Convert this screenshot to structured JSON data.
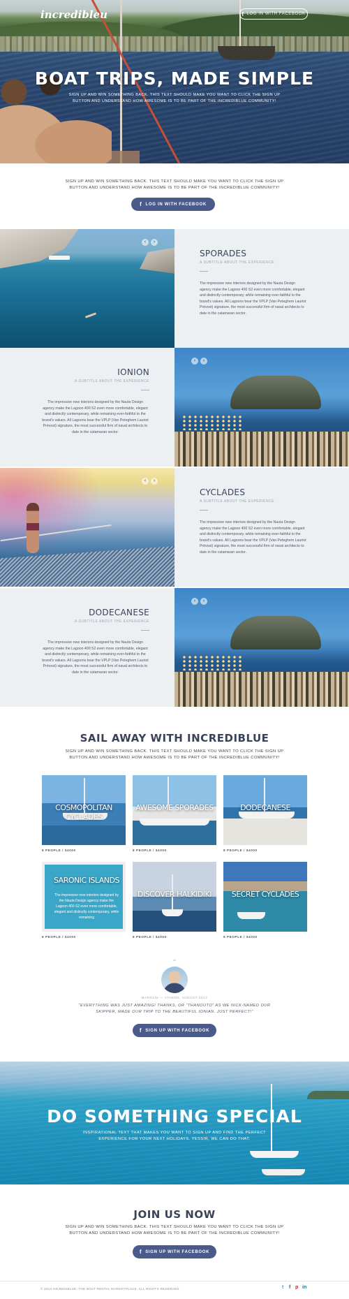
{
  "header": {
    "logo": "incredibleu",
    "login_button": "LOG IN WITH FACEBOOK"
  },
  "hero": {
    "title": "BOAT TRIPS, MADE SIMPLE",
    "subtitle": "SIGN UP AND WIN SOMETHING BACK. THIS TEXT SHOULD MAKE YOU WANT TO CLICK THE SIGN UP BUTTON AND UNDERSTAND HOW AWESOME IS TO BE PART OF THE INCREDIBLUE COMMUNITY!"
  },
  "intro": {
    "text": "SIGN UP AND WIN SOMETHING BACK. THIS TEXT SHOULD MAKE YOU WANT TO CLICK THE SIGN UP BUTTON AND UNDERSTAND HOW AWESOME IS TO BE PART OF THE INCREDIBLUE COMMUNITY!",
    "button": "LOG IN WITH FACEBOOK"
  },
  "destinations": [
    {
      "title": "SPORADES",
      "subtitle": "A SUBTITLE ABOUT THE EXPERIENCE",
      "body": "The impressive new interiors designed by the Nauta Design agency make the Lagoon 400 S2 even more comfortable, elegant and distinctly contemporary, while remaining ever-faithful to the brand's values. All Lagoons bear the VPLP (Van Peteghem Lauriot Prévost) signature, the most successful firm of naval architects to date in the catamaran sector."
    },
    {
      "title": "IONION",
      "subtitle": "A SUBTITLE ABOUT THE EXPERIENCE",
      "body": "The impressive new interiors designed by the Nauta Design agency make the Lagoon 400 S2 even more comfortable, elegant and distinctly contemporary, while remaining ever-faithful to the brand's values. All Lagoons bear the VPLP (Van Peteghem Lauriot Prévost) signature, the most successful firm of naval architects to date in the catamaran sector."
    },
    {
      "title": "CYCLADES",
      "subtitle": "A SUBTITLE ABOUT THE EXPERIENCE",
      "body": "The impressive new interiors designed by the Nauta Design agency make the Lagoon 400 S2 even more comfortable, elegant and distinctly contemporary, while remaining ever-faithful to the brand's values. All Lagoons bear the VPLP (Van Peteghem Lauriot Prévost) signature, the most successful firm of naval architects to date in the catamaran sector."
    },
    {
      "title": "DODECANESE",
      "subtitle": "A SUBTITLE ABOUT THE EXPERIENCE",
      "body": "The impressive new interiors designed by the Nauta Design agency make the Lagoon 400 S2 even more comfortable, elegant and distinctly contemporary, while remaining ever-faithful to the brand's values. All Lagoons bear the VPLP (Van Peteghem Lauriot Prévost) signature, the most successful firm of naval architects to date in the catamaran sector."
    }
  ],
  "sail_away": {
    "title": "SAIL AWAY WITH INCREDIBLUE",
    "text": "SIGN UP AND WIN SOMETHING BACK. THIS TEXT SHOULD MAKE YOU WANT TO CLICK THE SIGN UP BUTTON AND UNDERSTAND HOW AWESOME IS TO BE PART OF THE INCREDIBLUE COMMUNITY!",
    "tours": [
      {
        "label": "COSMOPOLITAN CYCLADES",
        "info": "8 PEOPLE / $4000"
      },
      {
        "label": "AWESOME SPORADES",
        "info": "8 PEOPLE / $4000"
      },
      {
        "label": "DODECANESE",
        "info": "8 PEOPLE / $4000"
      },
      {
        "label": "SARONIC ISLANDS",
        "info": "8 PEOPLE / $4000",
        "desc": "The impressive new interiors designed by the Nauta Design agency make the Lagoon 400 S2 even more comfortable, elegant and distinctly contemporary, while remaining"
      },
      {
        "label": "DISCOVER HALKIDIKI",
        "info": "8 PEOPLE / $4000"
      },
      {
        "label": "SECRET CYCLADES",
        "info": "8 PEOPLE / $4000"
      }
    ]
  },
  "testimonial": {
    "quote_mark": "“",
    "meta": "MANOLIS — ATHENS, AUGUST 2013",
    "quote": "“EVERYTHING WAS JUST AMAZING! THANKS, OR “THANOUTO” AS WE NICK-NAMED OUR SKIPPER, MADE OUR TRIP TO THE BEAUTIFUL IONIAN. JUST PERFECT!”",
    "button": "SIGN UP WITH FACEBOOK"
  },
  "special": {
    "title": "DO SOMETHING SPECIAL",
    "text": "INSPIRATIONAL TEXT THAT MAKES YOU WANT TO SIGN UP AND FIND THE PERFECT EXPERIENCE FOR YOUR NEXT HOLIDAYS. YESSIR, WE CAN DO THAT."
  },
  "join": {
    "title": "JOIN US NOW",
    "text": "SIGN UP AND WIN SOMETHING BACK. THIS TEXT SHOULD MAKE YOU WANT TO CLICK THE SIGN UP BUTTON AND UNDERSTAND HOW AWESOME IS TO BE PART OF THE INCREDIBLUE COMMUNITY!",
    "button": "SIGN UP WITH FACEBOOK"
  },
  "footer": {
    "copyright": "© 2014 INCREDIBLUE, THE BOAT RENTAL MARKETPLACE. ALL RIGHTS RESERVED.",
    "social": {
      "twitter": "t",
      "facebook": "f",
      "pinterest": "p",
      "linkedin": "in"
    }
  },
  "icons": {
    "facebook": "f",
    "prev": "‹",
    "next": "›"
  },
  "colors": {
    "brand": "#4a5a8a",
    "panel": "#ecf0f2",
    "twitter": "#3aa3e0",
    "facebook": "#3b5998",
    "pinterest": "#cb2027",
    "linkedin": "#0e76a8"
  }
}
